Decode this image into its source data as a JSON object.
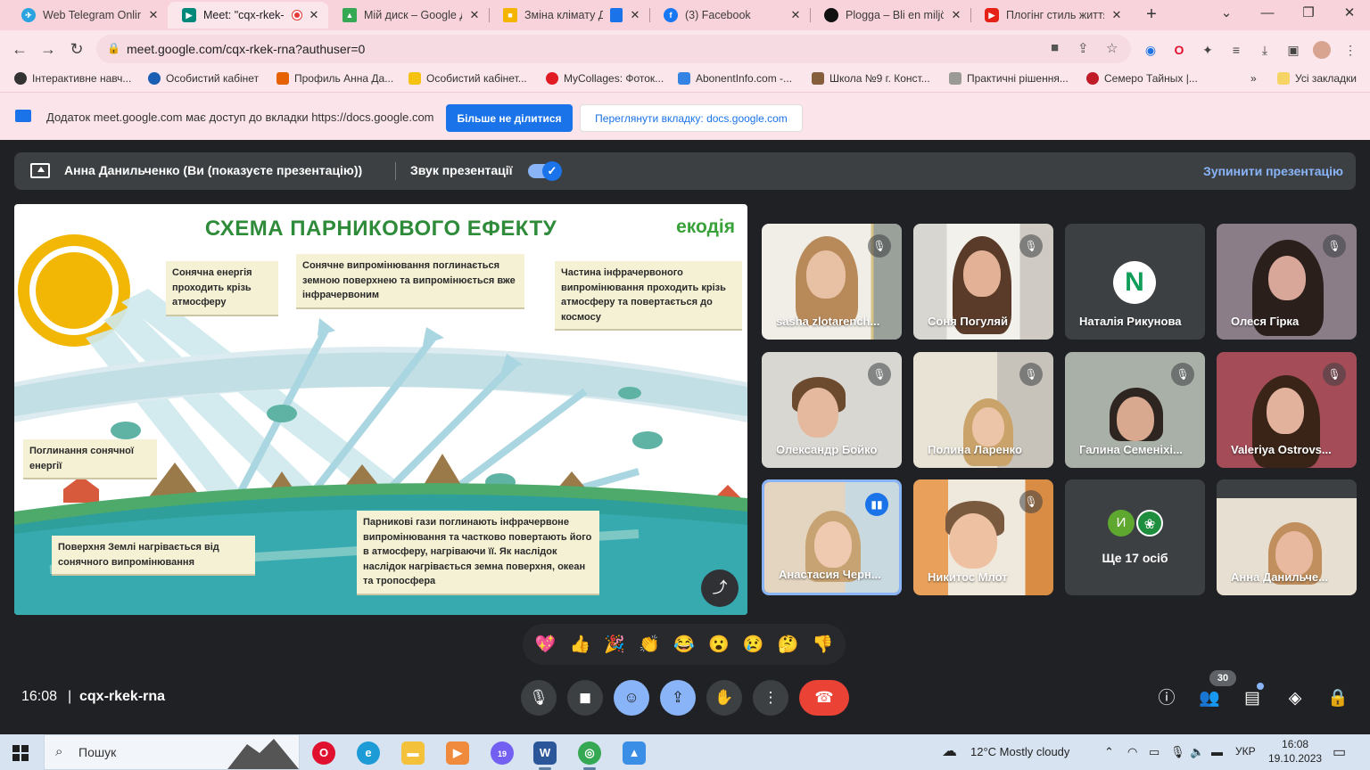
{
  "browser": {
    "tabs": [
      {
        "title": "Web Telegram Online",
        "color": "#2aa3e0",
        "glyph": "✈"
      },
      {
        "title": "Meet: \"cqx-rkek-",
        "color": "#00897b",
        "glyph": "▶",
        "recording": true
      },
      {
        "title": "Мій диск – Google Д",
        "color": "#fbbc04",
        "glyph": "▲"
      },
      {
        "title": "Зміна клімату Д",
        "color": "#f4b400",
        "glyph": "■"
      },
      {
        "title": "(3) Facebook",
        "color": "#1877f2",
        "glyph": "f"
      },
      {
        "title": "Plogga – Bli en miljö",
        "color": "#111111",
        "glyph": "●"
      },
      {
        "title": "Плогінг стиль життя",
        "color": "#e62117",
        "glyph": "▶"
      }
    ],
    "url": "meet.google.com/cqx-rkek-rna?authuser=0",
    "bookmarks": [
      {
        "label": "Інтерактивне навч...",
        "color": "#333"
      },
      {
        "label": "Особистий кабінет",
        "color": "#1a5fb4"
      },
      {
        "label": "Профиль Анна Да...",
        "color": "#e66100"
      },
      {
        "label": "Особистий кабінет...",
        "color": "#f5c211"
      },
      {
        "label": "MyCollages: Фоток...",
        "color": "#e01b24"
      },
      {
        "label": "AbonentInfo.com -...",
        "color": "#3584e4"
      },
      {
        "label": "Школа №9 г. Конст...",
        "color": "#865e3c"
      },
      {
        "label": "Практичні рішення...",
        "color": "#9a9996"
      },
      {
        "label": "Семеро Тайных |...",
        "color": "#c01c28"
      }
    ],
    "bookmarks_more": "»",
    "all_bookmarks": "Усі закладки",
    "infobar": {
      "message": "Додаток meet.google.com має доступ до вкладки https://docs.google.com",
      "primary": "Більше не ділитися",
      "secondary": "Переглянути вкладку: docs.google.com"
    }
  },
  "meet": {
    "presenter_text": "Анна Данильченко (Ви (показуєте презентацію))",
    "sound_label": "Звук презентації",
    "stop_label": "Зупинити презентацію",
    "slide": {
      "title": "СХЕМА ПАРНИКОВОГО ЕФЕКТУ",
      "brand": "екодія",
      "notes": [
        "Сонячна енергія проходить крізь атмосферу",
        "Сонячне випромінювання поглинається земною поверхнею та випромінюється вже інфрачервоним",
        "Частина інфрачервоного випромінювання проходить крізь атмосферу та повертається до космосу",
        "Поглинання сонячної енергії",
        "Поверхня Землі нагрівається від сонячного випромінювання",
        "Парникові гази поглинають інфрачервоне випромінювання та частково повертають його в атмосферу, нагріваючи її. Як наслідок наслідок нагрівається земна поверхня, океан та тропосфера"
      ]
    },
    "participants": [
      {
        "name": "sasha zlotarench...",
        "muted": true
      },
      {
        "name": "Соня Погуляй",
        "muted": true
      },
      {
        "name": "Наталія Рикунова",
        "muted": false,
        "avatar_letter": "N"
      },
      {
        "name": "Олеся Гірка",
        "muted": true
      },
      {
        "name": "Олександр Бойко",
        "muted": true
      },
      {
        "name": "Полина Ларенко",
        "muted": true
      },
      {
        "name": "Галина Семеніхі...",
        "muted": true
      },
      {
        "name": "Valeriya Ostrovs...",
        "muted": true
      },
      {
        "name": "Анастасия Черн...",
        "muted": false,
        "speaking": true
      },
      {
        "name": "Никитос Млот",
        "muted": true
      },
      {
        "name": "Анна Данильче...",
        "muted": false
      }
    ],
    "more": {
      "label": "Ще 17 осіб",
      "avatar_letter": "И"
    },
    "reactions": [
      "💖",
      "👍",
      "🎉",
      "👏",
      "😂",
      "😮",
      "😢",
      "🤔",
      "👎"
    ],
    "time": "16:08",
    "divider": "|",
    "code": "cqx-rkek-rna",
    "participant_count": "30"
  },
  "taskbar": {
    "search_placeholder": "Пошук",
    "weather": "12°C  Mostly cloudy",
    "lang": "УКР",
    "time": "16:08",
    "date": "19.10.2023",
    "viber_badge": "19"
  }
}
